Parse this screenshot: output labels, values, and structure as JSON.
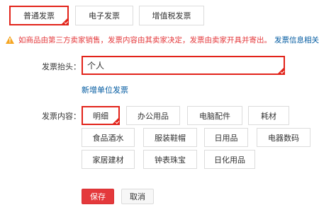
{
  "invoice_types": {
    "general": "普通发票",
    "electronic": "电子发票",
    "vat": "增值税发票",
    "selected": "general"
  },
  "notice": {
    "icon": "warning-icon",
    "text": "如商品由第三方卖家销售，发票内容由其卖家决定，发票由卖家开具并寄出。",
    "link": "发票信息相关"
  },
  "title_field": {
    "label": "发票抬头：",
    "value": "个人",
    "add_company_link": "新增单位发票"
  },
  "content_field": {
    "label": "发票内容：",
    "options": [
      "明细",
      "办公用品",
      "电脑配件",
      "耗材",
      "食品酒水",
      "服装鞋帽",
      "日用品",
      "电器数码",
      "家居建材",
      "钟表珠宝",
      "日化用品"
    ],
    "selected": "明细"
  },
  "actions": {
    "save": "保存",
    "cancel": "取消"
  },
  "colors": {
    "accent_red": "#e2231a",
    "link_blue": "#005aa0",
    "warning_orange": "#f5a623"
  }
}
